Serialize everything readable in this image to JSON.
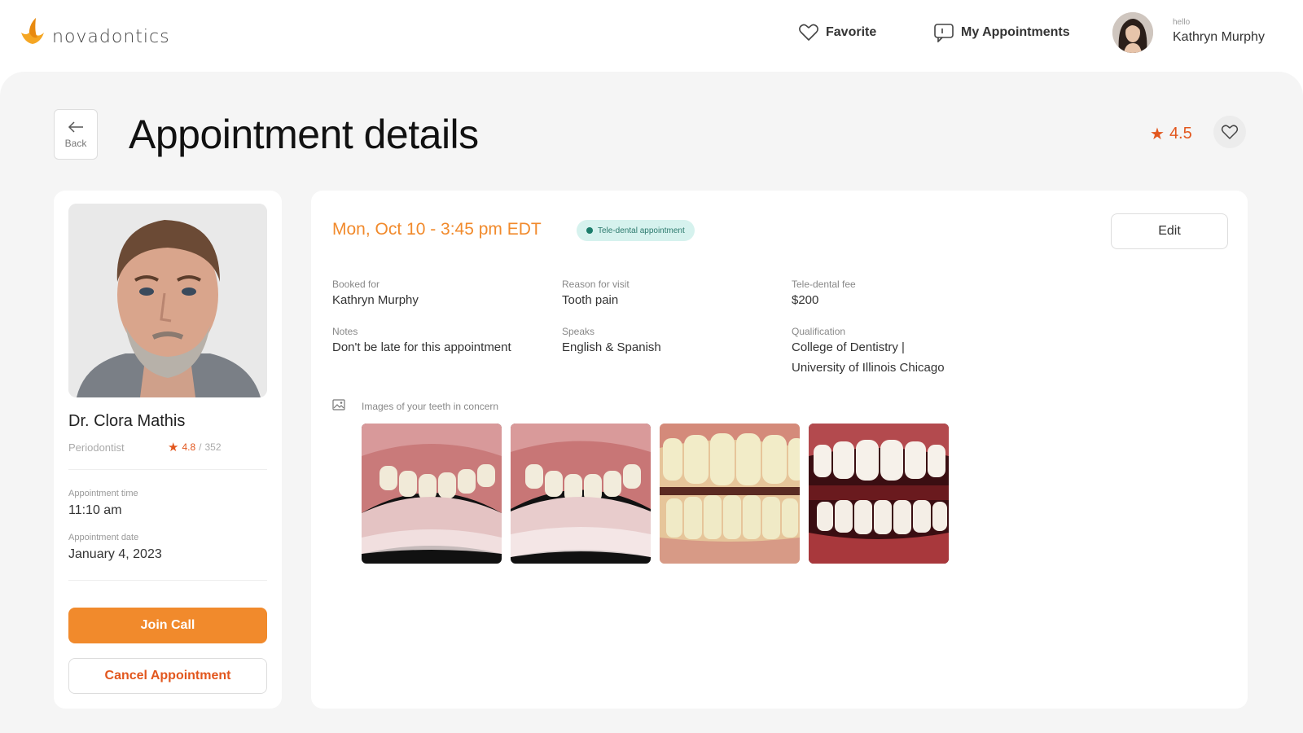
{
  "brand": {
    "name": "novadontics"
  },
  "nav": {
    "favorite_label": "Favorite",
    "appointments_label": "My Appointments",
    "user_greeting": "hello",
    "user_name": "Kathryn Murphy"
  },
  "page": {
    "back_label": "Back",
    "title": "Appointment details",
    "rating": "4.5"
  },
  "doctor": {
    "name": "Dr. Clora Mathis",
    "specialty": "Periodontist",
    "rating": "4.8",
    "reviews": "352",
    "appt_time_label": "Appointment time",
    "appt_time": "11:10 am",
    "appt_date_label": "Appointment date",
    "appt_date": "January 4, 2023",
    "join_label": "Join Call",
    "cancel_label": "Cancel Appointment"
  },
  "details": {
    "datetime": "Mon, Oct 10 - 3:45 pm EDT",
    "badge": "Tele-dental appointment",
    "edit_label": "Edit",
    "fields": {
      "booked_for_label": "Booked for",
      "booked_for": "Kathryn Murphy",
      "reason_label": "Reason for visit",
      "reason": "Tooth pain",
      "fee_label": "Tele-dental fee",
      "fee": "$200",
      "notes_label": "Notes",
      "notes": "Don't be late for this appointment",
      "speaks_label": "Speaks",
      "speaks": "English & Spanish",
      "qualification_label": "Qualification",
      "qualification_1": "College of Dentistry |",
      "qualification_2": "University of Illinois Chicago"
    },
    "images_label": "Images of your teeth in concern"
  },
  "colors": {
    "accent": "#f18a2c",
    "accent_dark": "#e2571e",
    "badge_bg": "#d6f2ee",
    "badge_text": "#2d7a6e"
  }
}
